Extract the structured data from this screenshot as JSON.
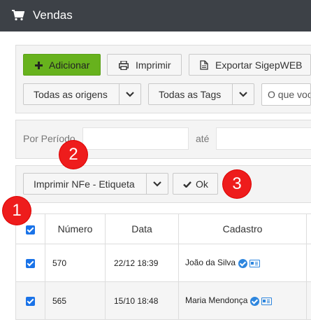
{
  "window": {
    "title": "Vendas",
    "icon": "shopping-cart-icon"
  },
  "toolbar": {
    "add_label": "Adicionar",
    "print_label": "Imprimir",
    "export_label": "Exportar SigepWEB",
    "origins_select": "Todas as origens",
    "tags_select": "Todas as Tags",
    "search_placeholder": "O que voce"
  },
  "period": {
    "label": "Por Período",
    "until_label": "até"
  },
  "actions": {
    "bulk_select": "Imprimir NFe - Etiqueta",
    "ok_label": "Ok"
  },
  "badges": [
    "1",
    "2",
    "3"
  ],
  "table": {
    "columns": [
      "Número",
      "Data",
      "Cadastro"
    ],
    "rows": [
      {
        "checked": true,
        "numero": "570",
        "data": "22/12 18:39",
        "cadastro": "João da Silva"
      },
      {
        "checked": true,
        "numero": "565",
        "data": "15/10 18:48",
        "cadastro": "Maria Mendonça"
      }
    ]
  },
  "colors": {
    "titlebar": "#3d4147",
    "add_button": "#67b21d",
    "badge": "#ee1c1c",
    "checkbox": "#1a73e8"
  }
}
